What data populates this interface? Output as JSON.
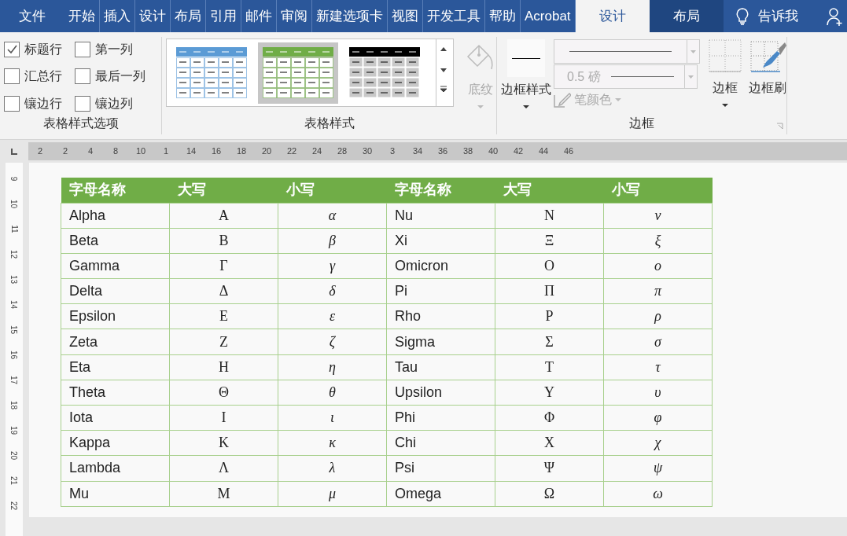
{
  "ribbon_tabs": [
    {
      "label": "文件",
      "selected": false,
      "kind": "file"
    },
    {
      "label": "开始",
      "selected": false,
      "kind": "tab"
    },
    {
      "label": "插入",
      "selected": false,
      "kind": "tab"
    },
    {
      "label": "设计",
      "selected": false,
      "kind": "tab"
    },
    {
      "label": "布局",
      "selected": false,
      "kind": "tab"
    },
    {
      "label": "引用",
      "selected": false,
      "kind": "tab"
    },
    {
      "label": "邮件",
      "selected": false,
      "kind": "tab"
    },
    {
      "label": "审阅",
      "selected": false,
      "kind": "tab"
    },
    {
      "label": "新建选项卡",
      "selected": false,
      "kind": "tab"
    },
    {
      "label": "视图",
      "selected": false,
      "kind": "tab"
    },
    {
      "label": "开发工具",
      "selected": false,
      "kind": "tab"
    },
    {
      "label": "帮助",
      "selected": false,
      "kind": "tab"
    },
    {
      "label": "Acrobat",
      "selected": false,
      "kind": "tab"
    },
    {
      "label": "设计",
      "selected": true,
      "kind": "context"
    },
    {
      "label": "布局",
      "selected": false,
      "kind": "context"
    }
  ],
  "tell_me": "告诉我",
  "style_options": {
    "label": "表格样式选项",
    "checkboxes": [
      {
        "label": "标题行",
        "checked": true
      },
      {
        "label": "第一列",
        "checked": false
      },
      {
        "label": "汇总行",
        "checked": false
      },
      {
        "label": "最后一列",
        "checked": false
      },
      {
        "label": "镶边行",
        "checked": false
      },
      {
        "label": "镶边列",
        "checked": false
      }
    ]
  },
  "table_styles": {
    "label": "表格样式",
    "styles": [
      {
        "color": "#5b9bd5",
        "selected": false
      },
      {
        "color": "#70ad47",
        "selected": true
      },
      {
        "color": "#000000",
        "selected": false
      }
    ],
    "shading": "底纹"
  },
  "borders": {
    "label": "边框",
    "border_styles": "边框样式",
    "weight": "0.5 磅",
    "pen_color": "笔颜色",
    "border": "边框",
    "border_painter": "边框刷"
  },
  "ruler_labels": [
    "2",
    "2",
    "4",
    "8",
    "10",
    "1",
    "14",
    "16",
    "18",
    "20",
    "22",
    "24",
    "28",
    "30",
    "3",
    "34",
    "36",
    "38",
    "40",
    "42",
    "44",
    "46"
  ],
  "vertical_ruler_labels": [
    "9",
    "10",
    "11",
    "12",
    "13",
    "14",
    "15",
    "16",
    "17",
    "18",
    "19",
    "20",
    "21",
    "22"
  ],
  "table": {
    "columns": [
      "字母名称",
      "大写",
      "小写",
      "字母名称",
      "大写",
      "小写"
    ],
    "rows": [
      [
        "Alpha",
        "Α",
        "α",
        "Nu",
        "Ν",
        "ν"
      ],
      [
        "Beta",
        "Β",
        "β",
        "Xi",
        "Ξ",
        "ξ"
      ],
      [
        "Gamma",
        "Γ",
        "γ",
        "Omicron",
        "Ο",
        "ο"
      ],
      [
        "Delta",
        "Δ",
        "δ",
        "Pi",
        "Π",
        "π"
      ],
      [
        "Epsilon",
        "Ε",
        "ε",
        "Rho",
        "Ρ",
        "ρ"
      ],
      [
        "Zeta",
        "Ζ",
        "ζ",
        "Sigma",
        "Σ",
        "σ"
      ],
      [
        "Eta",
        "Η",
        "η",
        "Tau",
        "Τ",
        "τ"
      ],
      [
        "Theta",
        "Θ",
        "θ",
        "Upsilon",
        "Υ",
        "υ"
      ],
      [
        "Iota",
        "Ι",
        "ι",
        "Phi",
        "Φ",
        "φ"
      ],
      [
        "Kappa",
        "Κ",
        "κ",
        "Chi",
        "Χ",
        "χ"
      ],
      [
        "Lambda",
        "Λ",
        "λ",
        "Psi",
        "Ψ",
        "ψ"
      ],
      [
        "Mu",
        "Μ",
        "μ",
        "Omega",
        "Ω",
        "ω"
      ]
    ]
  }
}
